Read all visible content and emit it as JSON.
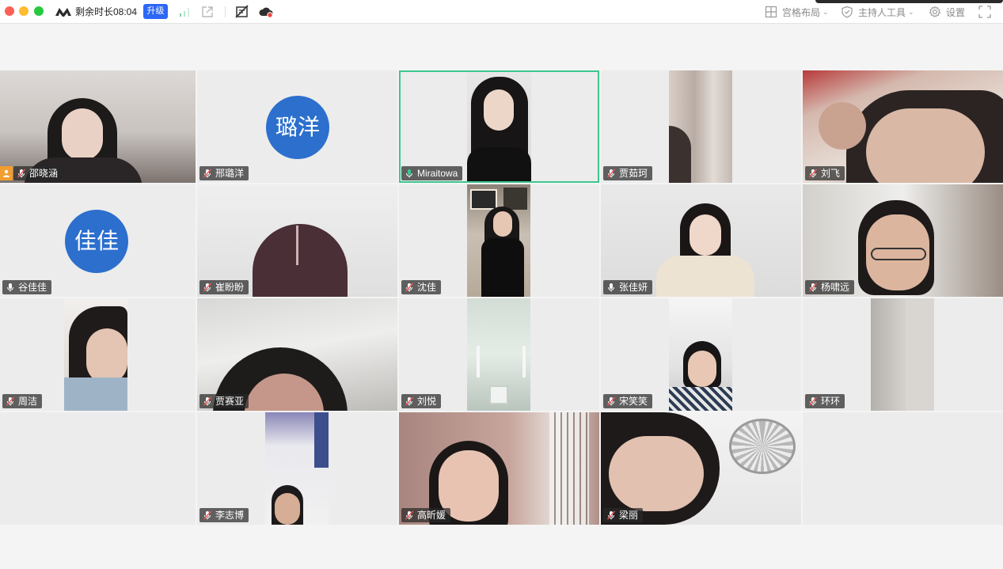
{
  "titlebar": {
    "remaining_time": "剩余时长08:04",
    "upgrade_label": "升级",
    "grid_layout_label": "宫格布局",
    "host_tools_label": "主持人工具",
    "settings_label": "设置"
  },
  "colors": {
    "accent_blue": "#2c67f6",
    "active_speaker_border": "#3cc78e",
    "avatar_bg": "#2c6fcd",
    "host_badge": "#f29d2f"
  },
  "participants": [
    {
      "name": "邵晓涵",
      "mic": "muted",
      "host": true
    },
    {
      "name": "邢璐洋",
      "mic": "muted",
      "avatar_text": "璐洋"
    },
    {
      "name": "Miraitowa",
      "mic": "speaking",
      "active_speaker": true
    },
    {
      "name": "贾茹珂",
      "mic": "muted"
    },
    {
      "name": "刘飞",
      "mic": "muted"
    },
    {
      "name": "谷佳佳",
      "mic": "on",
      "avatar_text": "佳佳"
    },
    {
      "name": "崔盼盼",
      "mic": "muted"
    },
    {
      "name": "沈佳",
      "mic": "muted"
    },
    {
      "name": "张佳妍",
      "mic": "on"
    },
    {
      "name": "杨啸远",
      "mic": "muted"
    },
    {
      "name": "周洁",
      "mic": "muted"
    },
    {
      "name": "贾赛亚",
      "mic": "muted"
    },
    {
      "name": "刘悦",
      "mic": "muted"
    },
    {
      "name": "宋笑笑",
      "mic": "muted"
    },
    {
      "name": "环环",
      "mic": "muted"
    },
    {
      "name": "李志博",
      "mic": "muted"
    },
    {
      "name": "高昕媛",
      "mic": "muted"
    },
    {
      "name": "梁丽",
      "mic": "muted"
    }
  ]
}
